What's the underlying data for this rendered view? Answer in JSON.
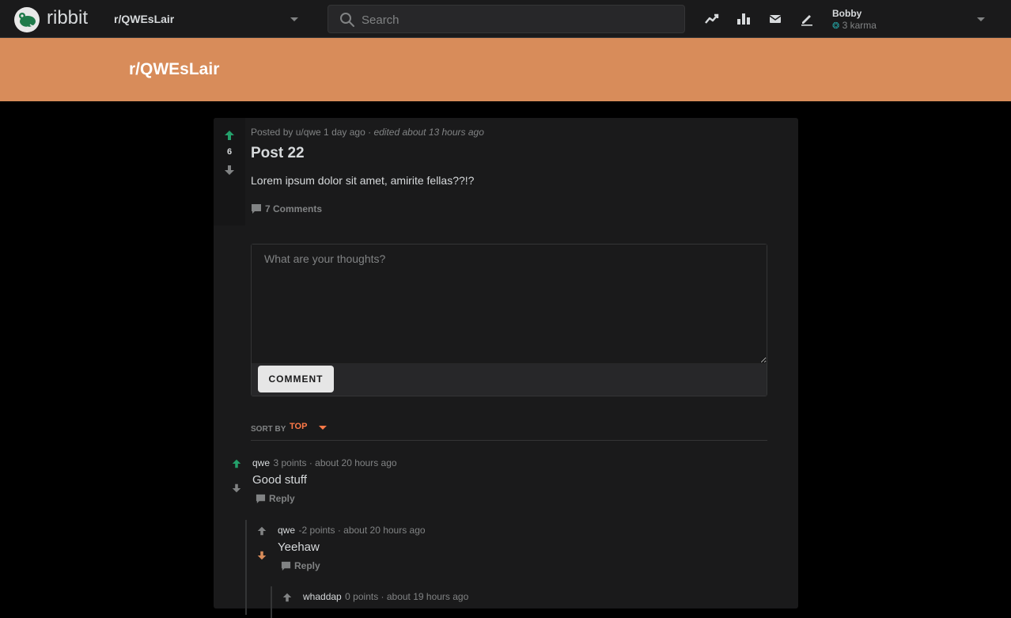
{
  "brand": "ribbit",
  "header": {
    "subreddit_select": "r/QWEsLair",
    "search_placeholder": "Search",
    "user": {
      "name": "Bobby",
      "karma": "3 karma"
    }
  },
  "banner": {
    "title": "r/QWEsLair"
  },
  "post": {
    "score": "6",
    "meta_prefix": "Posted by u/qwe 1 day ago · ",
    "meta_edited": "edited about 13 hours ago",
    "title": "Post 22",
    "body": "Lorem ipsum dolor sit amet, amirite fellas??!?",
    "comments_label": "7 Comments"
  },
  "comment_form": {
    "placeholder": "What are your thoughts?",
    "button": "COMMENT"
  },
  "sort": {
    "label": "SORT BY",
    "value": "TOP"
  },
  "comments": [
    {
      "author": "qwe",
      "meta": "3 points · about 20 hours ago",
      "text": "Good stuff",
      "reply": "Reply",
      "vote": "up"
    },
    {
      "author": "qwe",
      "meta": "-2 points · about 20 hours ago",
      "text": "Yeehaw",
      "reply": "Reply",
      "vote": "down"
    },
    {
      "author": "whaddap",
      "meta": "0 points · about 19 hours ago"
    }
  ],
  "colors": {
    "upvote": "#24a06b",
    "downvote": "#d88c5a",
    "banner": "#d88c5a",
    "sort_accent": "#ff7948"
  }
}
